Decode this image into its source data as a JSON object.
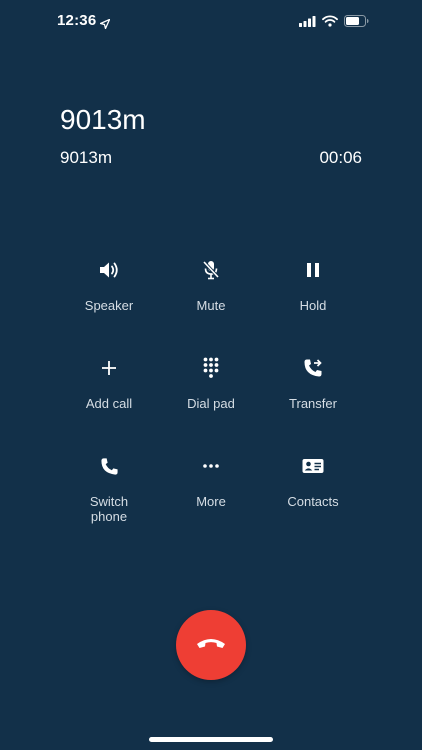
{
  "status_bar": {
    "time": "12:36",
    "location_icon": "location-arrow-icon",
    "signal_icon": "cellular-signal-icon",
    "wifi_icon": "wifi-icon",
    "battery_icon": "battery-icon"
  },
  "call": {
    "caller_name": "9013m",
    "caller_number": "9013m",
    "duration": "00:06"
  },
  "controls": {
    "speaker": {
      "label": "Speaker",
      "icon": "speaker-icon"
    },
    "mute": {
      "label": "Mute",
      "icon": "mic-off-icon"
    },
    "hold": {
      "label": "Hold",
      "icon": "pause-icon"
    },
    "add_call": {
      "label": "Add call",
      "icon": "plus-icon"
    },
    "dial_pad": {
      "label": "Dial pad",
      "icon": "dialpad-icon"
    },
    "transfer": {
      "label": "Transfer",
      "icon": "phone-forward-icon"
    },
    "switch_phone": {
      "label": "Switch phone",
      "icon": "phone-icon"
    },
    "more": {
      "label": "More",
      "icon": "more-dots-icon"
    },
    "contacts": {
      "label": "Contacts",
      "icon": "contact-card-icon"
    }
  },
  "end_call": {
    "icon": "hangup-icon"
  },
  "colors": {
    "background": "#123049",
    "end_call": "#ee3e34",
    "text": "#ffffff",
    "label": "#d5dde4"
  }
}
